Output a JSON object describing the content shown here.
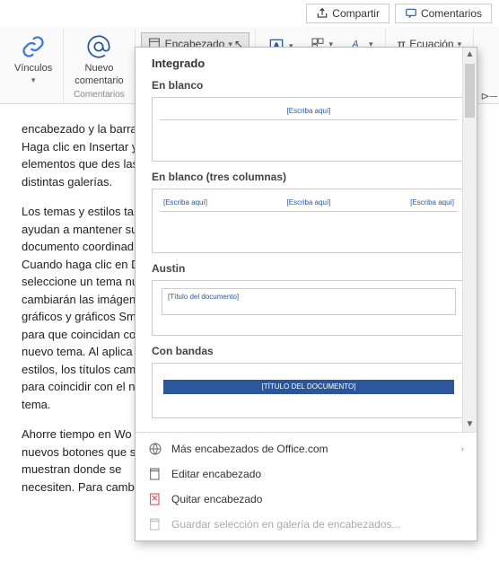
{
  "topbar": {
    "share": "Compartir",
    "comments": "Comentarios"
  },
  "ribbon": {
    "links": "Vínculos",
    "new_comment_line1": "Nuevo",
    "new_comment_line2": "comentario",
    "comments_group": "Comentarios",
    "header_btn": "Encabezado",
    "equation": "Ecuación"
  },
  "doc": {
    "p1": "encabezado y la barra Haga clic en Insertar y los elementos que des las distintas galerías.",
    "p2": "Los temas y estilos tan ayudan a mantener su documento coordinad Cuando haga clic en D seleccione un tema nu cambiarán las imágen gráficos y gráficos Sma para que coincidan co nuevo tema. Al aplica estilos, los títulos cam para coincidir con el n tema.",
    "p3": "Ahorre tiempo en Wo nuevos botones que s muestran donde se necesiten. Para cambi"
  },
  "flyout": {
    "title": "Integrado",
    "blank": "En blanco",
    "placeholder": "[Escriba aquí]",
    "blank3": "En blanco (tres columnas)",
    "austin": "Austin",
    "austin_text": "[Título del documento]",
    "bands": "Con bandas",
    "bands_text": "[TÍTULO DEL DOCUMENTO]"
  },
  "footer": {
    "more": "Más encabezados de Office.com",
    "edit": "Editar encabezado",
    "remove": "Quitar encabezado",
    "save": "Guardar selección en galería de encabezados..."
  }
}
